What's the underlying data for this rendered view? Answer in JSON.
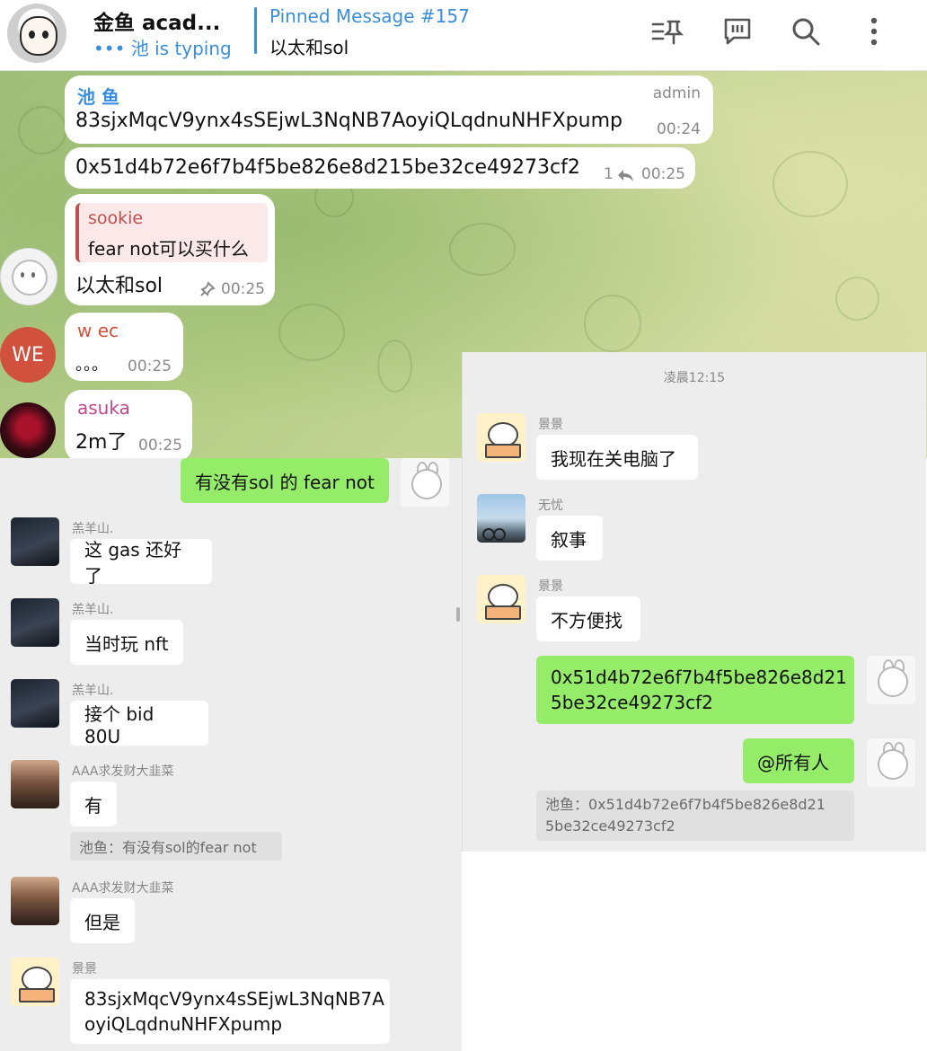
{
  "telegram": {
    "header": {
      "title": "金鱼 acad...",
      "typing": "••• 池 is typing",
      "pinned_title": "Pinned Message #157",
      "pinned_text": "以太和sol"
    },
    "messages": [
      {
        "sender": "池 鱼",
        "role": "admin",
        "text": "83sjxMqcV9ynx4sSEjwL3NqNB7AoyiQLqdnuNHFXpump",
        "time": "00:24"
      },
      {
        "text": "0x51d4b72e6f7b4f5be826e8d215be32ce49273cf2",
        "replies": "1",
        "time": "00:25"
      },
      {
        "reply_sender": "sookie",
        "reply_text": "fear not可以买什么",
        "text": "以太和sol",
        "time": "00:25"
      },
      {
        "sender": "w ec",
        "avatar_text": "WE",
        "text": "。。。",
        "time": "00:25"
      },
      {
        "sender": "asuka",
        "text": "2m了",
        "time": "00:25"
      }
    ]
  },
  "wechat_left": {
    "messages": [
      {
        "me": true,
        "text": "有没有sol 的 fear not"
      },
      {
        "sender": "羔羊山.",
        "text": "这 gas 还好了"
      },
      {
        "sender": "羔羊山.",
        "text": "当时玩 nft"
      },
      {
        "sender": "羔羊山.",
        "text": "接个 bid 80U"
      },
      {
        "sender": "AAA求发财大韭菜",
        "text": "有",
        "quote": "池鱼：有没有sol的fear not"
      },
      {
        "sender": "AAA求发财大韭菜",
        "text": "但是"
      },
      {
        "sender": "景景",
        "text_line1": "83sjxMqcV9ynx4sSEjwL3NqNB7A",
        "text_line2": "oyiQLqdnuNHFXpump"
      }
    ]
  },
  "wechat_right": {
    "timestamp": "凌晨12:15",
    "messages": [
      {
        "sender": "景景",
        "text": "我现在关电脑了"
      },
      {
        "sender": "无忧",
        "text": "叙事"
      },
      {
        "sender": "景景",
        "text": "不方便找"
      },
      {
        "me": true,
        "text_line1": "0x51d4b72e6f7b4f5be826e8d21",
        "text_line2": "5be32ce49273cf2"
      },
      {
        "me": true,
        "text": "@所有人",
        "quote_line1": "池鱼：0x51d4b72e6f7b4f5be826e8d21",
        "quote_line2": "5be32ce49273cf2"
      }
    ]
  },
  "colors": {
    "telegram_accent": "#3a8ede",
    "wechat_green": "#95ec69",
    "wechat_bg": "#ededed",
    "sookie_red": "#c0504d",
    "wec_red": "#d0513d",
    "asuka_pink": "#c0488c"
  },
  "icons": [
    "pin-list-icon",
    "feedback-icon",
    "search-icon",
    "more-vertical-icon",
    "forward-icon",
    "pin-icon"
  ]
}
